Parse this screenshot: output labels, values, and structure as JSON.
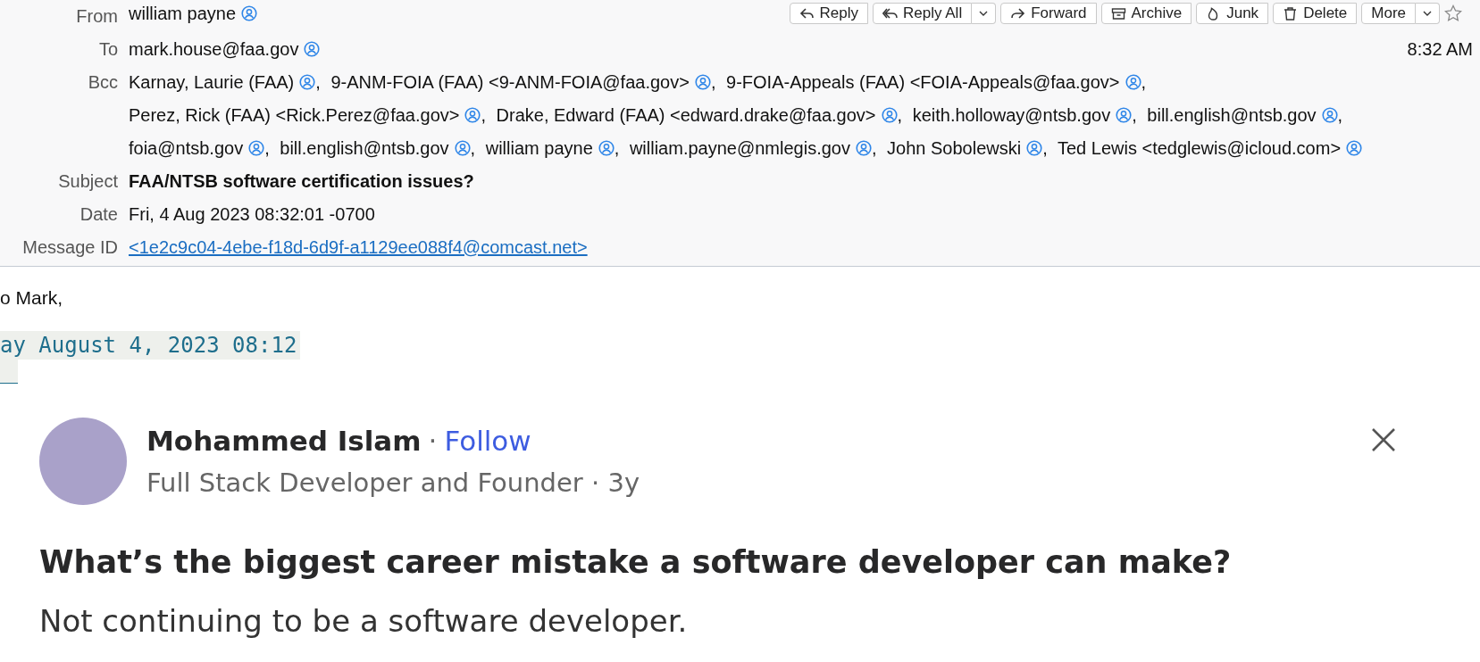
{
  "header": {
    "from": {
      "label": "From",
      "recipients": [
        {
          "name": "william payne"
        }
      ]
    },
    "actions": [
      {
        "kind": "reply",
        "label": "Reply",
        "menu": false
      },
      {
        "kind": "reply_all",
        "label": "Reply All",
        "menu": true
      },
      {
        "kind": "forward",
        "label": "Forward",
        "menu": false
      },
      {
        "kind": "archive",
        "label": "Archive",
        "menu": false
      },
      {
        "kind": "junk",
        "label": "Junk",
        "menu": false
      },
      {
        "kind": "delete",
        "label": "Delete",
        "menu": false
      },
      {
        "kind": "more",
        "label": "More",
        "menu": true
      }
    ],
    "starred": false,
    "time": "8:32 AM",
    "to": {
      "label": "To",
      "recipients": [
        {
          "name": "mark.house@faa.gov"
        }
      ]
    },
    "bcc": {
      "label": "Bcc",
      "recipients": [
        {
          "name": "Karnay, Laurie (FAA)",
          "separator": ","
        },
        {
          "name": "9-ANM-FOIA (FAA) <9-ANM-FOIA@faa.gov>",
          "separator": ","
        },
        {
          "name": "9-FOIA-Appeals (FAA) <FOIA-Appeals@faa.gov>",
          "separator": ","
        },
        {
          "name": "Perez, Rick (FAA) <Rick.Perez@faa.gov>",
          "separator": ","
        },
        {
          "name": "Drake, Edward (FAA) <edward.drake@faa.gov>",
          "separator": ","
        },
        {
          "name": "keith.holloway@ntsb.gov",
          "separator": ","
        },
        {
          "name": "bill.english@ntsb.gov",
          "separator": ","
        },
        {
          "name": "foia@ntsb.gov",
          "separator": ","
        },
        {
          "name": "bill.english@ntsb.gov",
          "separator": ","
        },
        {
          "name": "william payne",
          "separator": ","
        },
        {
          "name": "william.payne@nmlegis.gov",
          "separator": ","
        },
        {
          "name": "John Sobolewski",
          "separator": ","
        },
        {
          "name": "Ted Lewis <tedglewis@icloud.com>"
        }
      ]
    },
    "subject": {
      "label": "Subject",
      "value": "FAA/NTSB software certification issues?"
    },
    "date": {
      "label": "Date",
      "value": "Fri, 4 Aug 2023 08:32:01 -0700"
    },
    "message_id": {
      "label": "Message ID",
      "value": "<1e2c9c04-4ebe-f18d-6d9f-a1129ee088f4@comcast.net>"
    }
  },
  "body": {
    "greeting": "o Mark,",
    "quote_date": "ay August 4, 2023 08:12",
    "card": {
      "author": "Mohammed Islam",
      "dot": "·",
      "follow": "Follow",
      "bio": "Full Stack Developer and Founder · 3y",
      "question": "What’s the biggest career mistake a software developer can make?",
      "answer": "Not continuing to be a software developer."
    }
  }
}
